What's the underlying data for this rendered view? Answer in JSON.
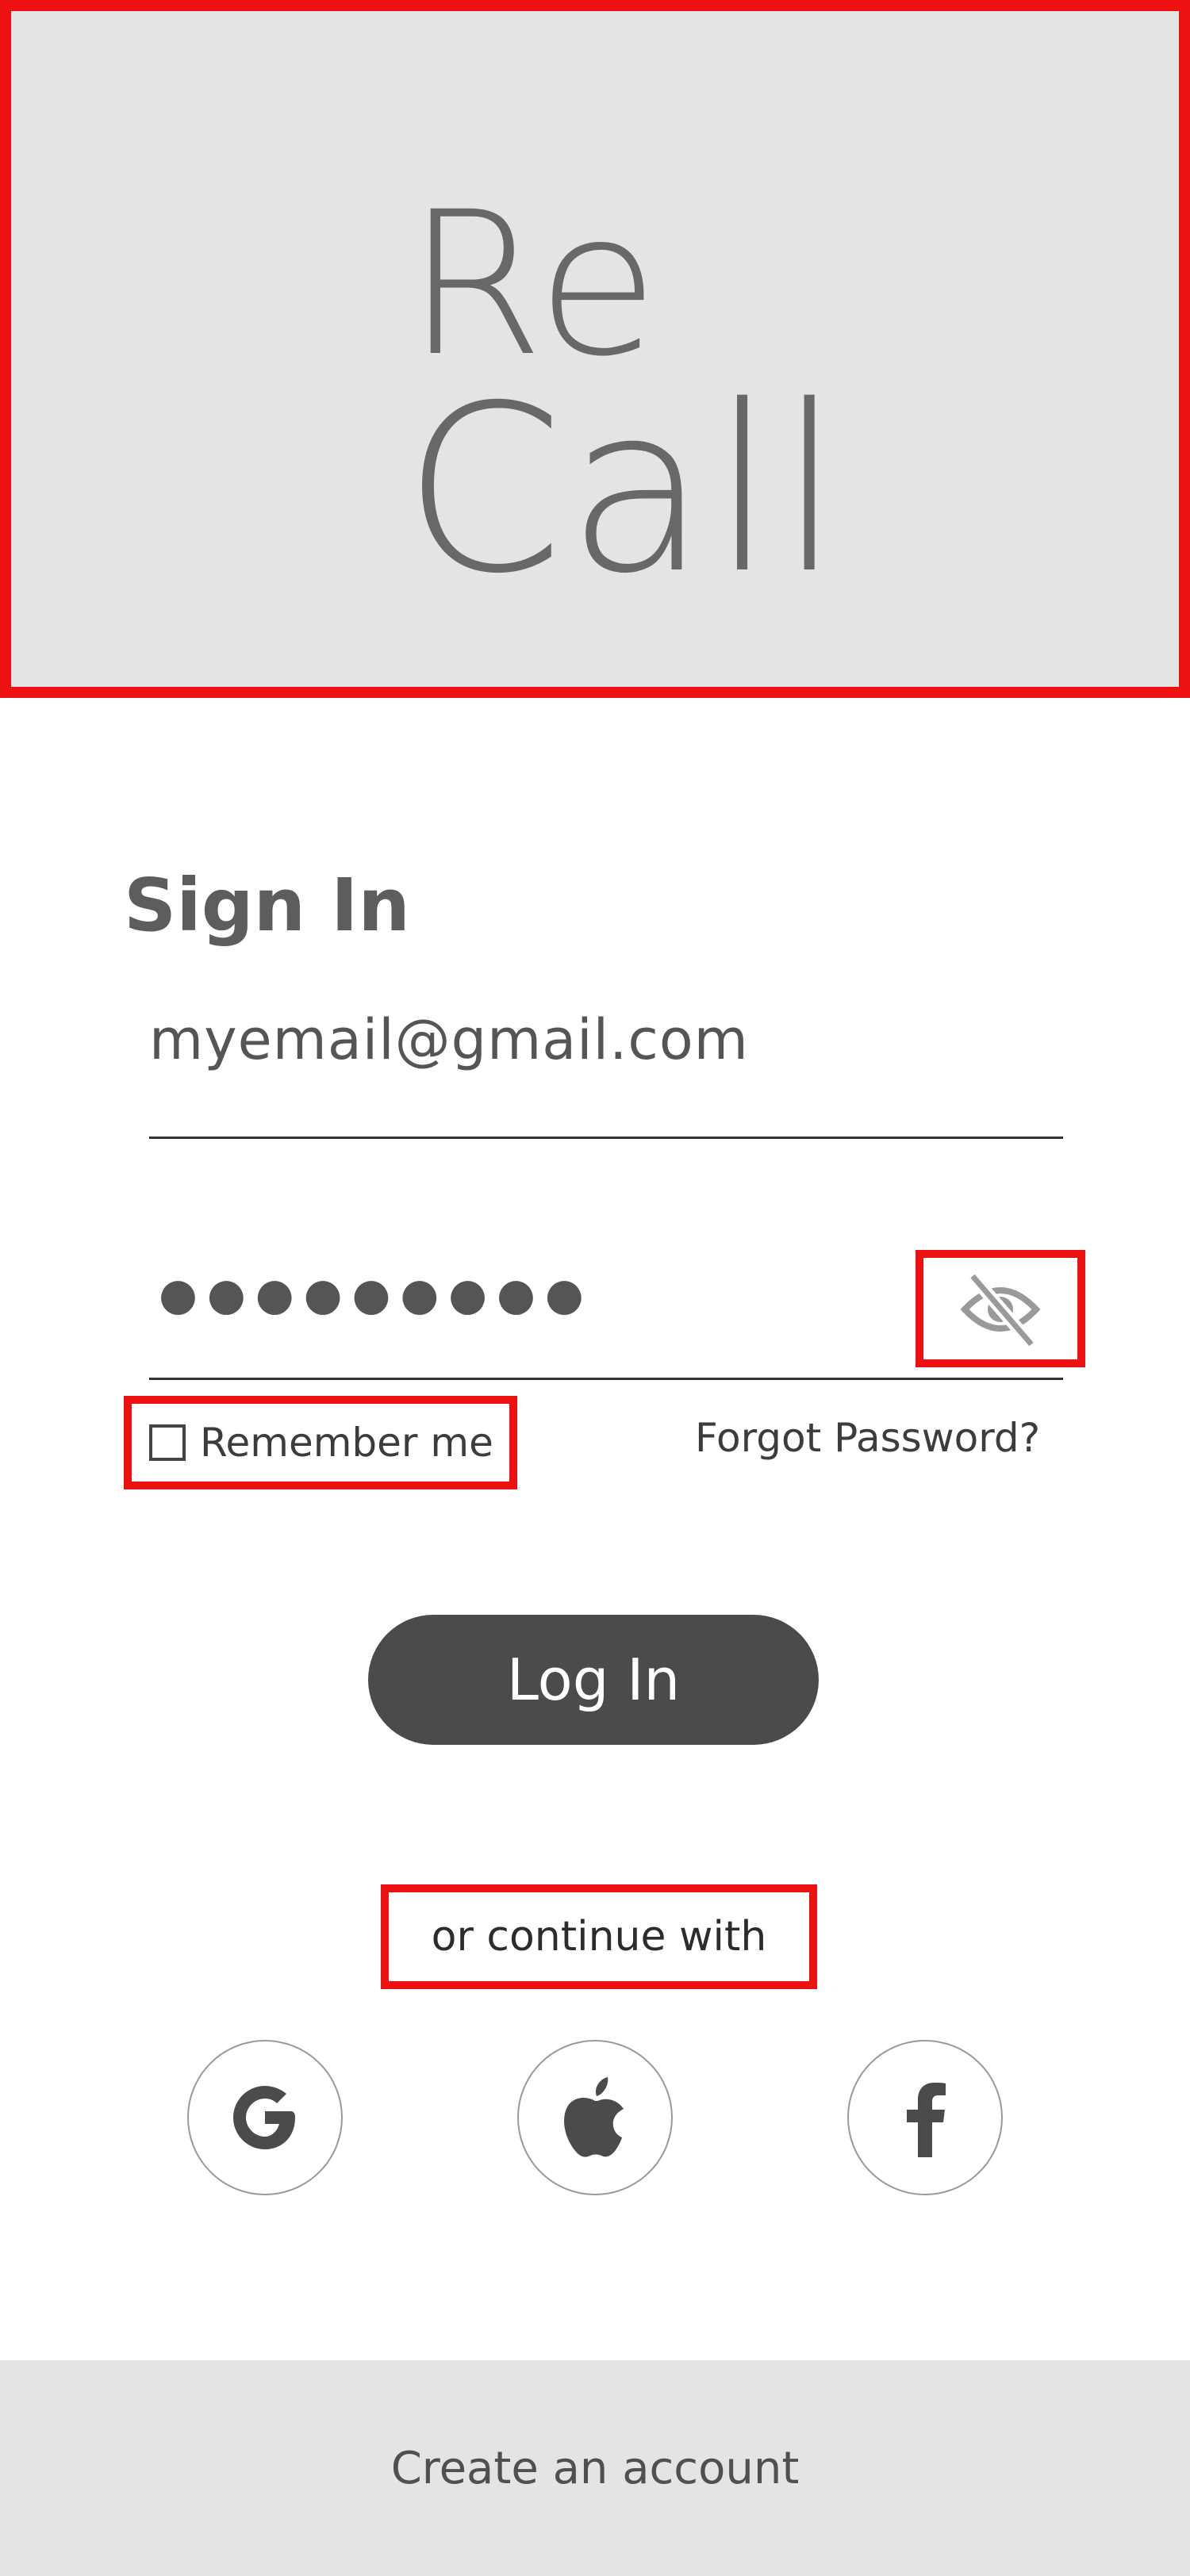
{
  "logo": {
    "line1": "Re",
    "line2": "Call"
  },
  "signin": {
    "title": "Sign In",
    "email_value": "myemail@gmail.com",
    "password_masked": "●●●●●●●●●",
    "password_toggle_icon": "eye-off-icon",
    "remember_label": "Remember me",
    "remember_checked": false,
    "forgot_label": "Forgot Password?",
    "login_label": "Log In"
  },
  "social": {
    "divider_label": "or continue with",
    "providers": [
      {
        "icon": "google-icon"
      },
      {
        "icon": "apple-icon"
      },
      {
        "icon": "facebook-icon"
      }
    ]
  },
  "footer": {
    "create_account_label": "Create an account"
  },
  "colors": {
    "panel_bg": "#e4e4e4",
    "button_bg": "#4b4b4b",
    "highlight": "#ee1111",
    "text": "#555555"
  }
}
